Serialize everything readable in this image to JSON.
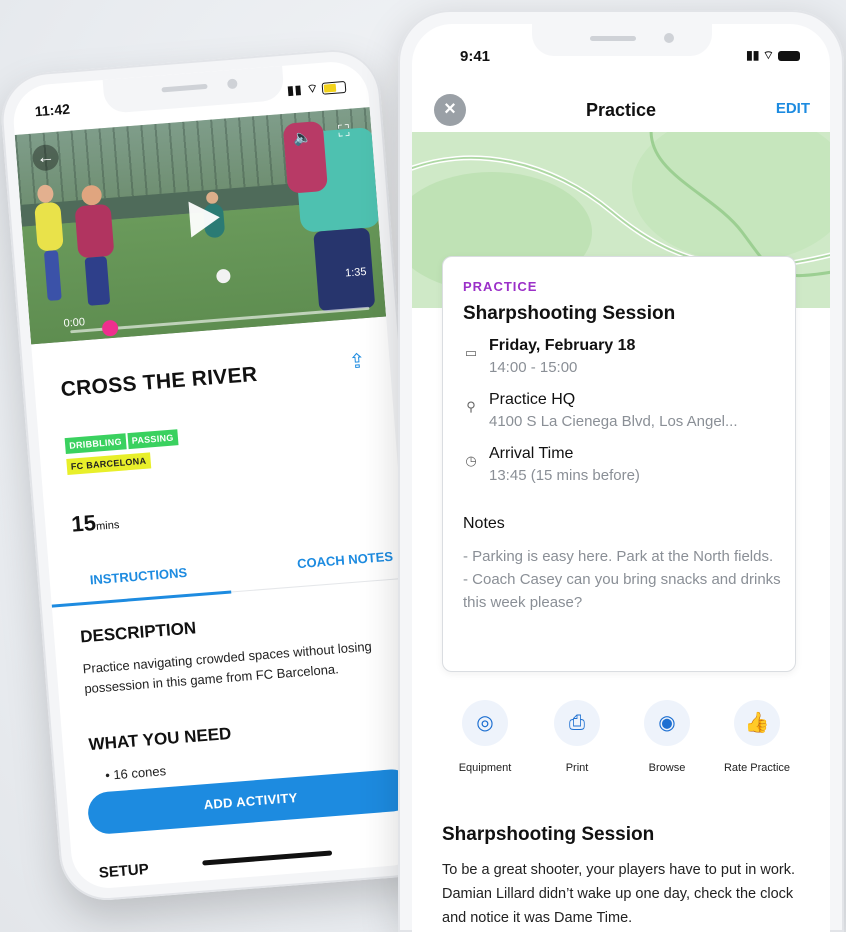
{
  "left_phone": {
    "status_time": "11:42",
    "status_icons": "▮▮ ⌔",
    "video": {
      "elapsed": "0:00",
      "duration": "1:35",
      "progress": 0.0
    },
    "title": "CROSS THE RIVER",
    "tags": [
      {
        "label": "DRIBBLING",
        "color": "#3ad15f"
      },
      {
        "label": "PASSING",
        "color": "#3ad15f"
      },
      {
        "label": "FC BARCELONA",
        "color": "#e8ef2a"
      }
    ],
    "duration_value": "15",
    "duration_unit": "mins",
    "tabs": [
      {
        "label": "INSTRUCTIONS",
        "active": true
      },
      {
        "label": "COACH NOTES",
        "active": false
      }
    ],
    "description_heading": "DESCRIPTION",
    "description_text": "Practice navigating crowded spaces without losing possession in this game from FC Barcelona.",
    "what_you_need_heading": "WHAT YOU NEED",
    "what_you_need_items": [
      "16 cones"
    ],
    "add_activity_label": "ADD ACTIVITY",
    "setup_heading": "SETUP"
  },
  "right_phone": {
    "status_time": "9:41",
    "status_icons": "▮▮ ⌔",
    "nav": {
      "title": "Practice",
      "edit_label": "EDIT",
      "close_glyph": "×"
    },
    "card": {
      "kicker": "PRACTICE",
      "title": "Sharpshooting Session",
      "date": {
        "main": "Friday, February 18",
        "sub": "14:00 - 15:00",
        "icon": "calendar-icon"
      },
      "location": {
        "main": "Practice HQ",
        "sub": "4100 S La Cienega Blvd, Los Angel...",
        "icon": "map-pin-icon"
      },
      "arrival": {
        "main": "Arrival Time",
        "sub": "13:45 (15 mins before)",
        "icon": "clock-icon"
      },
      "notes_label": "Notes",
      "notes_text_1": "- Parking is easy here. Park at the North fields.",
      "notes_text_2": "- Coach Casey can you bring snacks and drinks this week please?"
    },
    "actions": [
      {
        "label": "Equipment",
        "icon": "cones-icon",
        "glyph": "◎"
      },
      {
        "label": "Print",
        "icon": "printer-icon",
        "glyph": "⎙"
      },
      {
        "label": "Browse",
        "icon": "eye-icon",
        "glyph": "◉"
      },
      {
        "label": "Rate Practice",
        "icon": "thumbs-up-icon",
        "glyph": "👍"
      }
    ],
    "section_heading": "Sharpshooting Session",
    "section_text": "To be a great shooter, your players have to put in work. Damian Lillard didn’t wake up one day, check the clock and notice it was Dame Time."
  },
  "colors": {
    "accent_blue": "#1d8be0",
    "practice_purple": "#9b30c8",
    "tag_green": "#3ad15f",
    "tag_yellow": "#e8ef2a",
    "video_knob_pink": "#ee2f8e"
  }
}
